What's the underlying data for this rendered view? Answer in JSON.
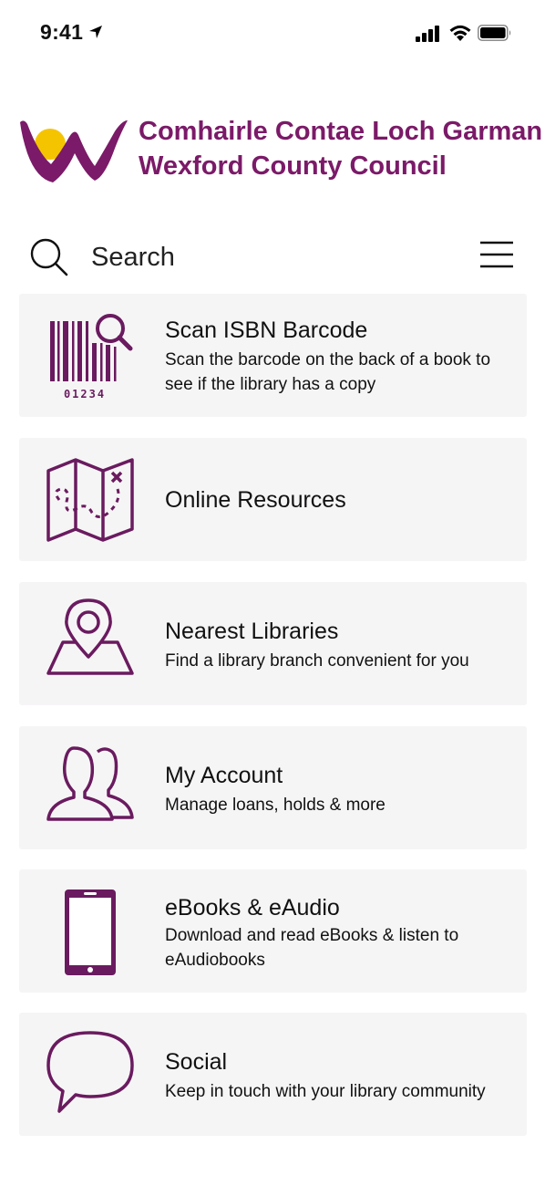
{
  "status_bar": {
    "time": "9:41",
    "icons": [
      "location-arrow-icon",
      "signal-icon",
      "wifi-icon",
      "battery-icon"
    ]
  },
  "header": {
    "org_name_irish": "Comhairle Contae Loch Garman",
    "org_name_english": "Wexford County Council",
    "logo_icon": "wexford-council-logo"
  },
  "search": {
    "placeholder": "Search",
    "icon": "search-icon",
    "menu_icon": "hamburger-menu-icon"
  },
  "menu_items": [
    {
      "title": "Scan ISBN Barcode",
      "subtitle": "Scan the barcode on the back of a book to see if the library has a copy",
      "icon": "barcode-scan-icon",
      "barcode_digits": "01234"
    },
    {
      "title": "Online Resources",
      "subtitle": "",
      "icon": "map-icon"
    },
    {
      "title": "Nearest Libraries",
      "subtitle": "Find a library branch convenient for you",
      "icon": "location-pin-icon"
    },
    {
      "title": "My Account",
      "subtitle": "Manage loans, holds & more",
      "icon": "users-icon"
    },
    {
      "title": "eBooks & eAudio",
      "subtitle": "Download and read eBooks & listen to eAudiobooks",
      "icon": "phone-icon"
    },
    {
      "title": "Social",
      "subtitle": "Keep in touch with your library community",
      "icon": "speech-bubble-icon"
    }
  ],
  "colors": {
    "brand_purple": "#6a1b5f",
    "org_text": "#7b1a68",
    "logo_yellow": "#f5c400",
    "card_bg": "#f6f5f6"
  }
}
